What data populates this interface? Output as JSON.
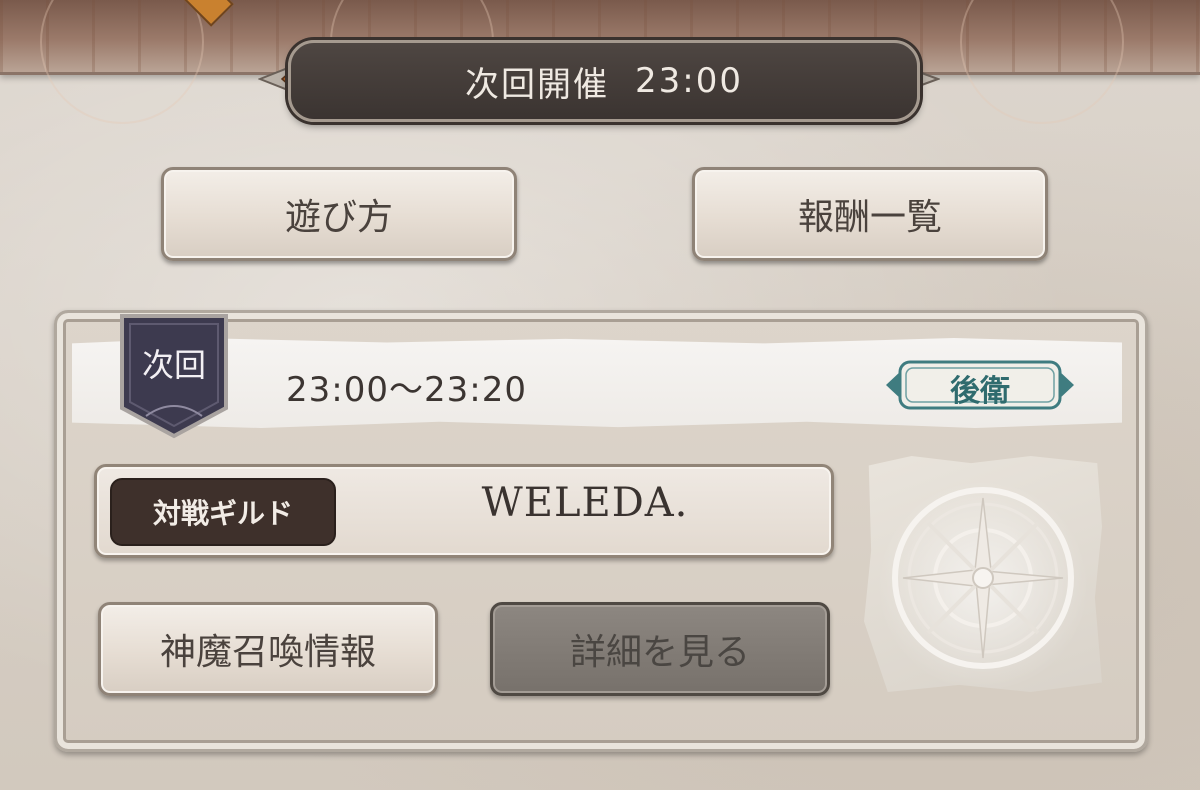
{
  "header": {
    "label": "次回開催",
    "time": "23:00"
  },
  "buttons": {
    "how_to_play": "遊び方",
    "reward_list": "報酬一覧",
    "summon_info": "神魔召喚情報",
    "view_details": "詳細を見る"
  },
  "next_battle": {
    "banner": "次回",
    "time_range": "23:00〜23:20",
    "role": "後衛",
    "opponent_label": "対戦ギルド",
    "opponent_name": "WELEDA."
  },
  "icons": {
    "emblem": "compass-emblem-icon",
    "header_ornament": "gem-ornament-icon"
  },
  "colors": {
    "header_plate": "#3b3431",
    "role_accent": "#2f6b6e",
    "banner": "#3d3a4f",
    "guild_tag": "#3e302b"
  }
}
